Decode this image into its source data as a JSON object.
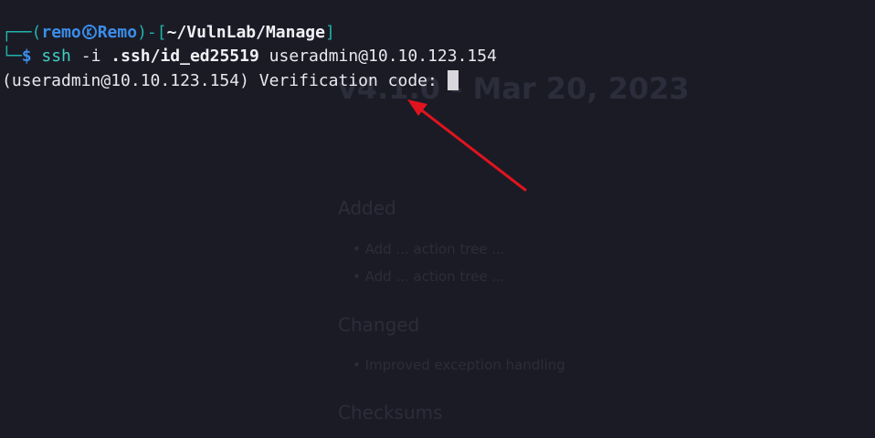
{
  "prompt": {
    "box_top": "┌──",
    "open_paren": "(",
    "user": "remo",
    "host": "Remo",
    "close_dash_bracket": ")-[",
    "path": "~/VulnLab/Manage",
    "close_bracket": "]",
    "box_bottom": "└─",
    "dollar": "$"
  },
  "command": {
    "program": "ssh",
    "flag": "-i",
    "keyfile": ".ssh/id_ed25519",
    "target": "useradmin@10.10.123.154"
  },
  "output": {
    "verification_prompt": "(useradmin@10.10.123.154) Verification code: "
  },
  "background_page": {
    "version_heading": "v4.1.0 - Mar 20, 2023",
    "sections": [
      "Added",
      "Changed",
      "Checksums"
    ],
    "added_items": [
      "Add ... action tree ...",
      "Add ... action tree ..."
    ],
    "changed_items": [
      "Improved exception handling"
    ]
  },
  "colors": {
    "background": "#1b1b26",
    "prompt_frame": "#20b3aa",
    "user_host": "#3b8eea",
    "text": "#e8e8ee",
    "annotation_arrow": "#e0141e"
  }
}
